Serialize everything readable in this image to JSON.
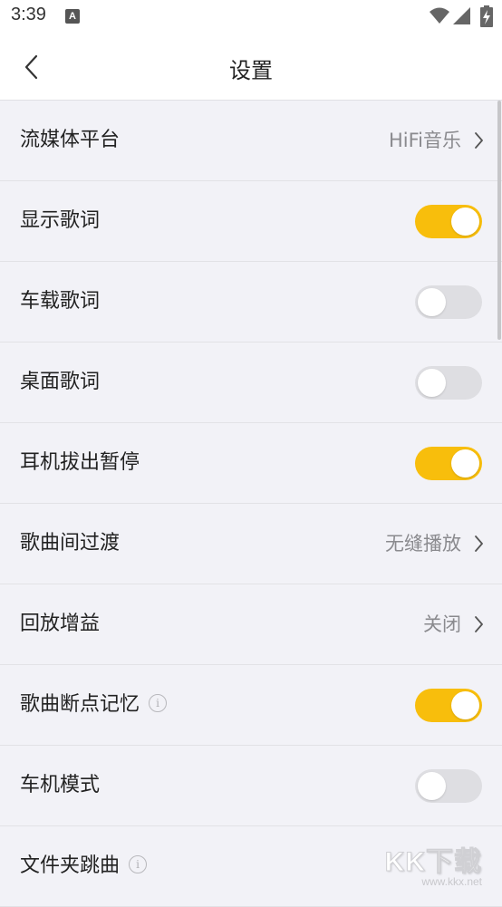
{
  "status_bar": {
    "time": "3:39",
    "notification_icon": "A"
  },
  "header": {
    "title": "设置",
    "back_icon": "chevron-left-icon"
  },
  "settings": [
    {
      "label": "流媒体平台",
      "type": "value",
      "value": "HiFi音乐",
      "has_info": false
    },
    {
      "label": "显示歌词",
      "type": "toggle",
      "on": true,
      "has_info": false
    },
    {
      "label": "车载歌词",
      "type": "toggle",
      "on": false,
      "has_info": false
    },
    {
      "label": "桌面歌词",
      "type": "toggle",
      "on": false,
      "has_info": false
    },
    {
      "label": "耳机拔出暂停",
      "type": "toggle",
      "on": true,
      "has_info": false
    },
    {
      "label": "歌曲间过渡",
      "type": "value",
      "value": "无缝播放",
      "has_info": false
    },
    {
      "label": "回放增益",
      "type": "value",
      "value": "关闭",
      "has_info": false
    },
    {
      "label": "歌曲断点记忆",
      "type": "toggle",
      "on": true,
      "has_info": true
    },
    {
      "label": "车机模式",
      "type": "toggle",
      "on": false,
      "has_info": false
    },
    {
      "label": "文件夹跳曲",
      "type": "none",
      "has_info": true
    }
  ],
  "colors": {
    "toggle_on": "#f8be0c",
    "toggle_off": "#dedee2",
    "background": "#f2f2f7"
  },
  "watermark": {
    "logo": "KK下载",
    "url": "www.kkx.net"
  }
}
